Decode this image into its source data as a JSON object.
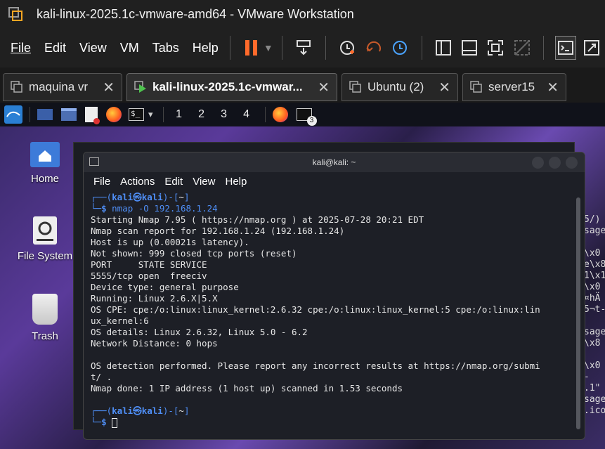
{
  "window": {
    "title": "kali-linux-2025.1c-vmware-amd64 - VMware Workstation"
  },
  "menu": {
    "items": [
      {
        "label": "File"
      },
      {
        "label": "Edit"
      },
      {
        "label": "View"
      },
      {
        "label": "VM"
      },
      {
        "label": "Tabs"
      },
      {
        "label": "Help"
      }
    ]
  },
  "tabs": [
    {
      "label": "maquina vr"
    },
    {
      "label": "kali-linux-2025.1c-vmwar..."
    },
    {
      "label": "Ubuntu (2)"
    },
    {
      "label": "server15"
    }
  ],
  "tab_close": "✕",
  "panel": {
    "workspaces": [
      "1",
      "2",
      "3",
      "4"
    ],
    "badge": "3",
    "dropdown": "▾"
  },
  "desktop": {
    "icons": [
      {
        "label": "Home"
      },
      {
        "label": "File System"
      },
      {
        "label": "Trash"
      }
    ]
  },
  "terminal": {
    "title": "kali@kali: ~",
    "menu": [
      "File",
      "Actions",
      "Edit",
      "View",
      "Help"
    ],
    "prompt": {
      "user": "kali",
      "at": "㉿",
      "host": "kali",
      "dir": "~"
    },
    "command": "nmap -O 192.168.1.24",
    "output": [
      "Starting Nmap 7.95 ( https://nmap.org ) at 2025-07-28 20:21 EDT",
      "Nmap scan report for 192.168.1.24 (192.168.1.24)",
      "Host is up (0.00021s latency).",
      "Not shown: 999 closed tcp ports (reset)",
      "PORT     STATE SERVICE",
      "5555/tcp open  freeciv",
      "Device type: general purpose",
      "Running: Linux 2.6.X|5.X",
      "OS CPE: cpe:/o:linux:linux_kernel:2.6.32 cpe:/o:linux:linux_kernel:5 cpe:/o:linux:lin",
      "ux_kernel:6",
      "OS details: Linux 2.6.32, Linux 5.0 - 6.2",
      "Network Distance: 0 hops",
      "",
      "OS detection performed. Please report any incorrect results at https://nmap.org/submi",
      "t/ .",
      "Nmap done: 1 IP address (1 host up) scanned in 1.53 seconds"
    ]
  },
  "background_window_right_text": [
    "5/)",
    "sage",
    "",
    "\\x0",
    "e\\x8",
    "1\\x1",
    "\\x0",
    "¤hÄ",
    "5¬t-",
    "",
    "sage",
    "\\x8",
    "",
    "\\x0",
    "-",
    ".1\"",
    "sage",
    ".ico"
  ],
  "colors": {
    "prompt_blue": "#4f8ff7",
    "accent_orange": "#ff6a2b"
  }
}
